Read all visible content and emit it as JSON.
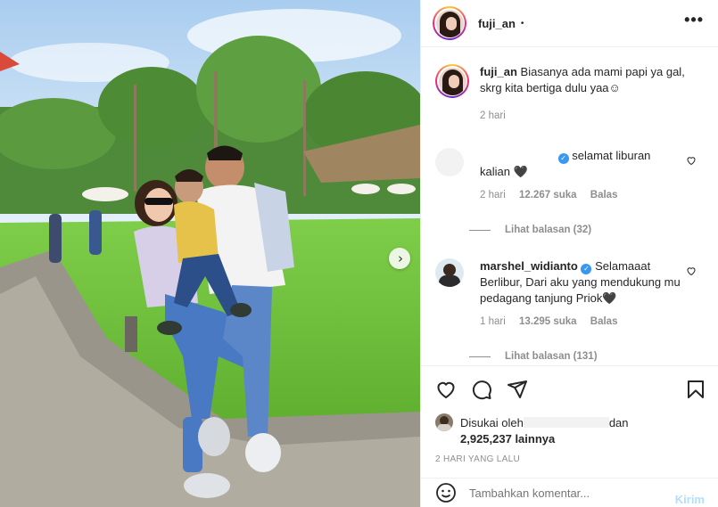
{
  "post": {
    "username": "fuji_an",
    "separator": "•",
    "more_icon": "more-horizontal-icon",
    "next_icon": "chevron-right-icon"
  },
  "caption": {
    "username": "fuji_an",
    "text": "Biasanya ada mami papi ya gal, skrg kita bertiga dulu yaa☺",
    "time": "2 hari"
  },
  "comments": [
    {
      "username": "",
      "text": "selamat liburan kalian 🖤",
      "verified": true,
      "time": "2 hari",
      "likes": "12.267 suka",
      "reply_label": "Balas",
      "view_replies": "Lihat balasan (32)"
    },
    {
      "username": "marshel_widianto",
      "text": "Selamaaat Berlibur, Dari aku yang mendukung mu pedagang tanjung Priok🖤",
      "verified": true,
      "time": "1 hari",
      "likes": "13.295 suka",
      "reply_label": "Balas",
      "view_replies": "Lihat balasan (131)"
    }
  ],
  "likes": {
    "liked_by_prefix": "Disukai oleh",
    "liked_by_suffix": "dan",
    "count": "2,925,237 lainnya"
  },
  "date": "2 HARI YANG LALU",
  "add_comment": {
    "placeholder": "Tambahkan komentar...",
    "post_label": "Kirim",
    "emoji_icon": "smiley-icon"
  },
  "colors": {
    "verified": "#3897f0",
    "post_button": "#b2dffc",
    "secondary_text": "#8e8e8e"
  }
}
